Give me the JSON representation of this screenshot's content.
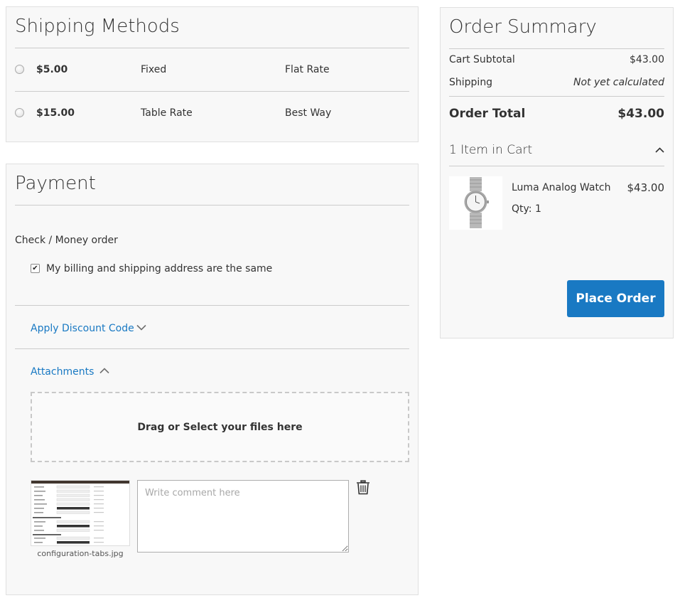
{
  "shipping": {
    "title": "Shipping Methods",
    "methods": [
      {
        "price": "$5.00",
        "method": "Fixed",
        "carrier": "Flat Rate"
      },
      {
        "price": "$15.00",
        "method": "Table Rate",
        "carrier": "Best Way"
      }
    ]
  },
  "payment": {
    "title": "Payment",
    "method_label": "Check / Money order",
    "billing_same_label": "My billing and shipping address are the same",
    "billing_same_checked": true,
    "discount_label": "Apply Discount Code",
    "attachments_label": "Attachments",
    "dropzone_label": "Drag or Select your files here",
    "attachment": {
      "filename": "configuration-tabs.jpg",
      "comment_placeholder": "Write comment here"
    }
  },
  "summary": {
    "title": "Order Summary",
    "subtotal_label": "Cart Subtotal",
    "subtotal_value": "$43.00",
    "shipping_label": "Shipping",
    "shipping_value": "Not yet calculated",
    "total_label": "Order Total",
    "total_value": "$43.00",
    "items_label": "1 Item in Cart",
    "item": {
      "name": "Luma Analog Watch",
      "price": "$43.00",
      "qty": "Qty: 1"
    },
    "place_order_label": "Place Order"
  },
  "colors": {
    "accent": "#1979c3",
    "panel_bg": "#f8f8f8",
    "divider": "#cccccc"
  },
  "icons": [
    "radio-icon",
    "checkbox-icon",
    "chevron-down-icon",
    "chevron-up-icon",
    "trash-icon",
    "watch-image"
  ]
}
